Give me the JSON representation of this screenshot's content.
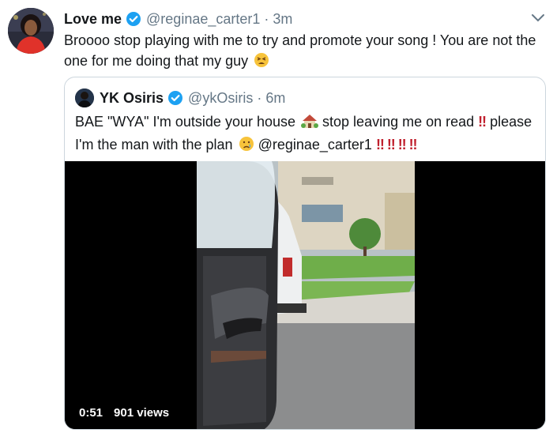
{
  "tweet": {
    "display_name": "Love me",
    "handle": "@reginae_carter1",
    "separator": "·",
    "time": "3m",
    "text": "Broooo stop playing with me to try and promote your song ! You are not the one for me doing that my guy",
    "emoji_end": "tired-face"
  },
  "quote": {
    "display_name": "YK Osiris",
    "handle": "@ykOsiris",
    "separator": "·",
    "time": "6m",
    "text_part1": "BAE \"WYA\" I'm outside your house",
    "text_part2": "stop leaving me on read",
    "text_part3": "please I'm the man with the plan",
    "mention": "@reginae_carter1",
    "bangs": "‼ ‼ ‼ ‼",
    "bang_single": "‼",
    "emojis": [
      "house-with-garden",
      "double-exclamation",
      "crying-face"
    ]
  },
  "video": {
    "duration": "0:51",
    "views": "901 views"
  },
  "colors": {
    "verified": "#1da1f2",
    "secondary_text": "#657786",
    "alert_red": "#c0202d"
  }
}
